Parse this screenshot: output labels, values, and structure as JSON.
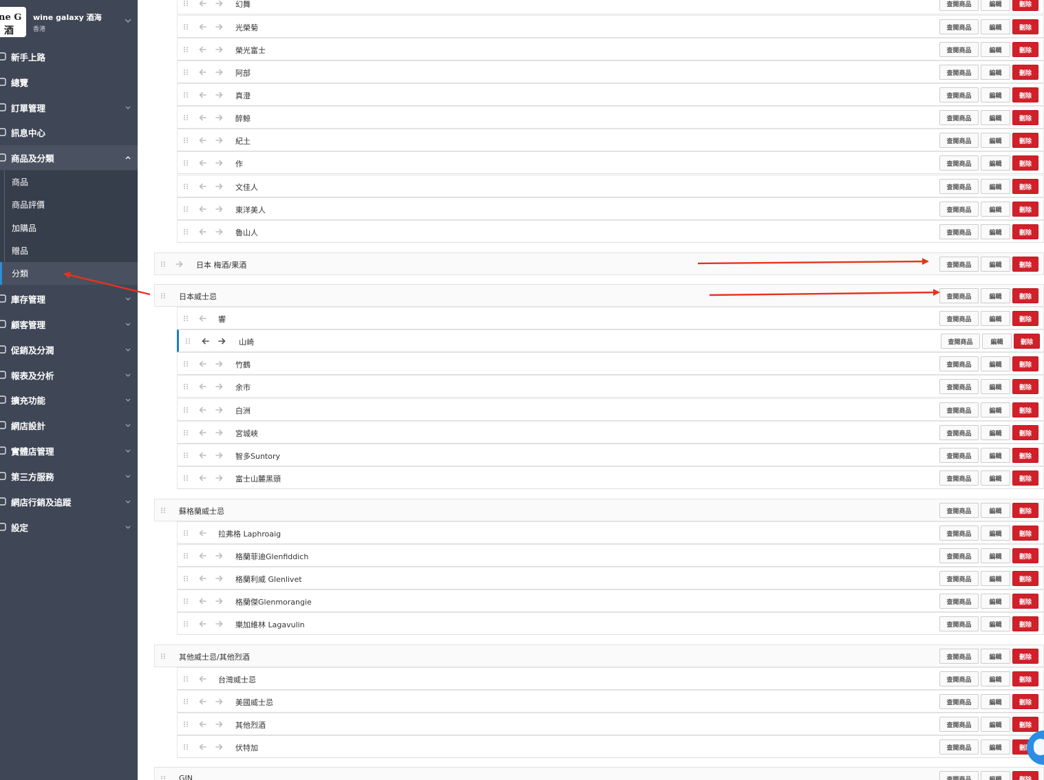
{
  "store": {
    "logo_line1": "ne G",
    "logo_line2": "酒",
    "name": "wine galaxy 酒海",
    "region": "香港"
  },
  "nav": [
    {
      "label": "新手上路",
      "icon": "rocket-icon",
      "has_chevron": false,
      "active": false
    },
    {
      "label": "總覽",
      "icon": "grid-icon",
      "has_chevron": false,
      "active": false
    },
    {
      "label": "訂單管理",
      "icon": "document-icon",
      "has_chevron": true,
      "active": false
    },
    {
      "label": "訊息中心",
      "icon": "chat-icon",
      "has_chevron": false,
      "active": false
    },
    {
      "label": "商品及分類",
      "icon": "tag-icon",
      "has_chevron": true,
      "active": true
    },
    {
      "label": "庫存管理",
      "icon": "warehouse-icon",
      "has_chevron": true,
      "active": false
    },
    {
      "label": "顧客管理",
      "icon": "user-icon",
      "has_chevron": true,
      "active": false
    },
    {
      "label": "促銷及分潤",
      "icon": "promo-tag-icon",
      "has_chevron": true,
      "active": false
    },
    {
      "label": "報表及分析",
      "icon": "chart-icon",
      "has_chevron": true,
      "active": false
    },
    {
      "label": "擴充功能",
      "icon": "puzzle-icon",
      "has_chevron": true,
      "active": false
    },
    {
      "label": "網店設計",
      "icon": "brush-icon",
      "has_chevron": true,
      "active": false
    },
    {
      "label": "實體店管理",
      "icon": "store-icon",
      "has_chevron": true,
      "active": false
    },
    {
      "label": "第三方服務",
      "icon": "globe-icon",
      "has_chevron": true,
      "active": false
    },
    {
      "label": "網店行銷及追蹤",
      "icon": "megaphone-icon",
      "has_chevron": true,
      "active": false
    },
    {
      "label": "設定",
      "icon": "gear-icon",
      "has_chevron": true,
      "active": false
    }
  ],
  "subnav": [
    {
      "label": "商品",
      "selected": false
    },
    {
      "label": "商品評價",
      "selected": false
    },
    {
      "label": "加購品",
      "selected": false
    },
    {
      "label": "贈品",
      "selected": false
    },
    {
      "label": "分類",
      "selected": true
    }
  ],
  "buttons": {
    "view": "查閱商品",
    "edit": "編輯",
    "delete": "刪除"
  },
  "categories": [
    {
      "label": "幻舞",
      "level": 2,
      "arrows": "both"
    },
    {
      "label": "光榮菊",
      "level": 2,
      "arrows": "both"
    },
    {
      "label": "榮光富士",
      "level": 2,
      "arrows": "both"
    },
    {
      "label": "阿部",
      "level": 2,
      "arrows": "both"
    },
    {
      "label": "真澄",
      "level": 2,
      "arrows": "both"
    },
    {
      "label": "醉鯨",
      "level": 2,
      "arrows": "both"
    },
    {
      "label": "紀土",
      "level": 2,
      "arrows": "both"
    },
    {
      "label": "作",
      "level": 2,
      "arrows": "both"
    },
    {
      "label": "文佳人",
      "level": 2,
      "arrows": "both"
    },
    {
      "label": "東洋美人",
      "level": 2,
      "arrows": "both"
    },
    {
      "label": "魯山人",
      "level": 2,
      "arrows": "both"
    },
    {
      "label": "日本 梅酒/果酒",
      "level": 0,
      "arrows": "right"
    },
    {
      "label": "日本威士忌",
      "level": 0,
      "arrows": "none"
    },
    {
      "label": "響",
      "level": 1,
      "arrows": "left"
    },
    {
      "label": "山崎",
      "level": 2,
      "arrows": "both",
      "highlight": true
    },
    {
      "label": "竹鶴",
      "level": 2,
      "arrows": "both"
    },
    {
      "label": "余市",
      "level": 2,
      "arrows": "both"
    },
    {
      "label": "白洲",
      "level": 2,
      "arrows": "both"
    },
    {
      "label": "宮城峽",
      "level": 2,
      "arrows": "both"
    },
    {
      "label": "智多Suntory",
      "level": 2,
      "arrows": "both"
    },
    {
      "label": "富士山麓黑頭",
      "level": 2,
      "arrows": "both"
    },
    {
      "label": "蘇格蘭威士忌",
      "level": 0,
      "arrows": "none"
    },
    {
      "label": "拉弗格 Laphroaig",
      "level": 1,
      "arrows": "left"
    },
    {
      "label": "格蘭菲迪Glenfiddich",
      "level": 2,
      "arrows": "both"
    },
    {
      "label": "格蘭利威 Glenlivet",
      "level": 2,
      "arrows": "both"
    },
    {
      "label": "格蘭傑Glenmorangie",
      "level": 2,
      "arrows": "both"
    },
    {
      "label": "樂加維林 Lagavulin",
      "level": 2,
      "arrows": "both"
    },
    {
      "label": "其他威士忌/其他烈酒",
      "level": 0,
      "arrows": "none"
    },
    {
      "label": "台灣威士忌",
      "level": 1,
      "arrows": "left"
    },
    {
      "label": "美國威士忌",
      "level": 2,
      "arrows": "both"
    },
    {
      "label": "其他烈酒",
      "level": 2,
      "arrows": "both"
    },
    {
      "label": "伏特加",
      "level": 2,
      "arrows": "both"
    },
    {
      "label": "GIN",
      "level": 0,
      "arrows": "none"
    }
  ],
  "colors": {
    "sidebar": "#3f4756",
    "delete": "#d0202a",
    "annotation": "#e8321c",
    "highlight": "#1c7cc4"
  }
}
